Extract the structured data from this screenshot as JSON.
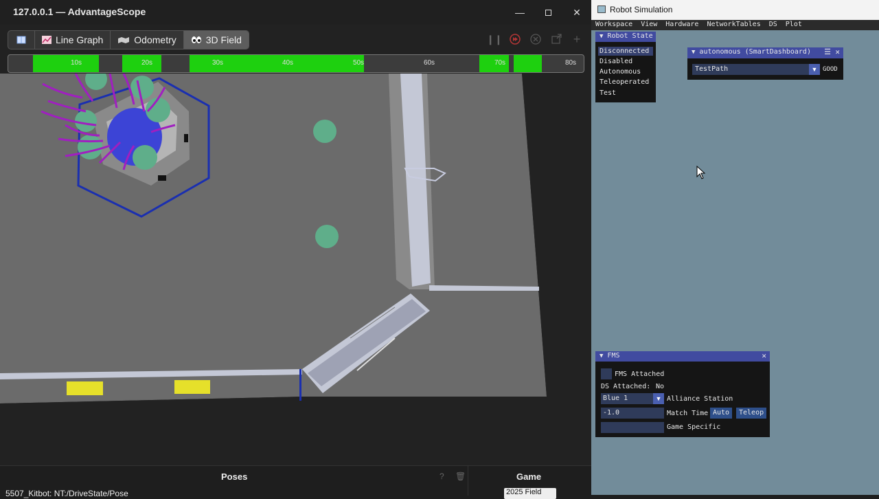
{
  "advantagescope": {
    "title": "127.0.0.1 — AdvantageScope",
    "tabs": [
      {
        "label": ""
      },
      {
        "label": "Line Graph"
      },
      {
        "label": "Odometry"
      },
      {
        "label": "3D Field"
      }
    ],
    "timeline_ticks": [
      "10s",
      "20s",
      "30s",
      "40s",
      "50s",
      "60s",
      "70s",
      "80s"
    ],
    "bottom": {
      "poses_title": "Poses",
      "game_title": "Game",
      "pose_row": "5507_Kitbot: NT:/DriveState/Pose",
      "game_select": "2025 Field"
    },
    "colors": {
      "timeline_enabled": "#1ed00f",
      "carpet": "#6b6b6b",
      "alliance_blue": "#1a2fb0"
    }
  },
  "sim": {
    "title": "Robot Simulation",
    "menu": [
      "Workspace",
      "View",
      "Hardware",
      "NetworkTables",
      "DS",
      "Plot"
    ],
    "robot_state": {
      "title": "Robot State",
      "items": [
        "Disconnected",
        "Disabled",
        "Autonomous",
        "Teleoperated",
        "Test"
      ]
    },
    "auto_chooser": {
      "title": "autonomous (SmartDashboard)",
      "selected": "TestPath",
      "status": "GOOD"
    },
    "fms": {
      "title": "FMS",
      "fms_attached_label": "FMS Attached",
      "ds_attached_label": "DS Attached:",
      "ds_attached_value": "No",
      "alliance_value": "Blue 1",
      "alliance_label": "Alliance Station",
      "match_time_value": "-1.0",
      "match_time_label": "Match Time",
      "auto_button": "Auto",
      "teleop_button": "Teleop",
      "game_specific_label": "Game Specific"
    },
    "colors": {
      "background": "#728c9a",
      "title_bar": "#414ba0"
    }
  }
}
